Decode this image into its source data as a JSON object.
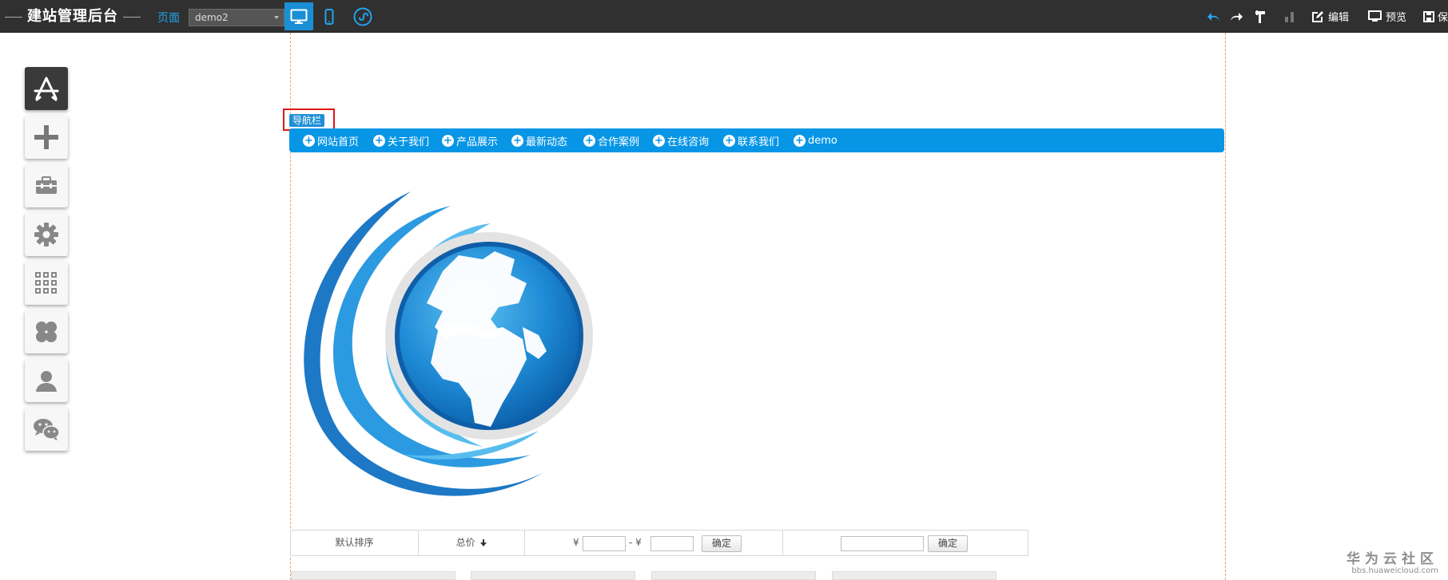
{
  "topbar": {
    "title": "建站管理后台",
    "page_label": "页面",
    "page_select_value": "demo2",
    "edit_label": "编辑",
    "preview_label": "预览",
    "save_label": "保"
  },
  "nav_module": {
    "tag_label": "导航栏",
    "items": [
      "网站首页",
      "关于我们",
      "产品展示",
      "最新动态",
      "合作案例",
      "在线咨询",
      "联系我们",
      "demo"
    ]
  },
  "filter": {
    "sort_default": "默认排序",
    "total_price": "总价",
    "currency": "¥",
    "range_sep": "- ¥",
    "confirm": "确定",
    "confirm2": "确定"
  },
  "watermark": {
    "line1": "华为云社区",
    "line2": "bbs.huaweicloud.com"
  },
  "colors": {
    "accent": "#0796e6",
    "topbar_bg": "#303030",
    "highlight_border": "#e01515"
  }
}
